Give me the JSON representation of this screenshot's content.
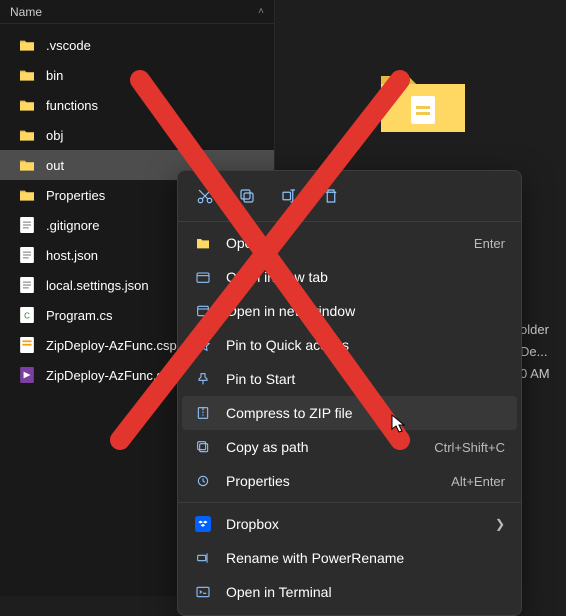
{
  "header": {
    "name_col": "Name"
  },
  "files": [
    {
      "label": ".vscode",
      "kind": "folder"
    },
    {
      "label": "bin",
      "kind": "folder"
    },
    {
      "label": "functions",
      "kind": "folder"
    },
    {
      "label": "obj",
      "kind": "folder"
    },
    {
      "label": "out",
      "kind": "folder",
      "selected": true
    },
    {
      "label": "Properties",
      "kind": "folder"
    },
    {
      "label": ".gitignore",
      "kind": "file"
    },
    {
      "label": "host.json",
      "kind": "file"
    },
    {
      "label": "local.settings.json",
      "kind": "file"
    },
    {
      "label": "Program.cs",
      "kind": "code"
    },
    {
      "label": "ZipDeploy-AzFunc.csproj",
      "kind": "proj"
    },
    {
      "label": "ZipDeploy-AzFunc.sln",
      "kind": "sln"
    }
  ],
  "context_menu": {
    "open": {
      "label": "Open",
      "accel": "Enter"
    },
    "open_new_tab": {
      "label": "Open in new tab"
    },
    "open_new_window": {
      "label": "Open in new window"
    },
    "pin_quick": {
      "label": "Pin to Quick access"
    },
    "pin_start": {
      "label": "Pin to Start"
    },
    "compress_zip": {
      "label": "Compress to ZIP file"
    },
    "copy_as_path": {
      "label": "Copy as path",
      "accel": "Ctrl+Shift+C"
    },
    "properties": {
      "label": "Properties",
      "accel": "Alt+Enter"
    },
    "dropbox": {
      "label": "Dropbox"
    },
    "power_rename": {
      "label": "Rename with PowerRename"
    },
    "open_terminal": {
      "label": "Open in Terminal"
    }
  },
  "peek": {
    "line1": "older",
    "line2": "De...",
    "line3": "0 AM"
  },
  "colors": {
    "folder_yellow": "#ffd864",
    "folder_tab": "#e6b93f",
    "menu_icon": "#8fc5ff",
    "dropbox_blue": "#0061ff",
    "red_x": "#e2352e"
  }
}
